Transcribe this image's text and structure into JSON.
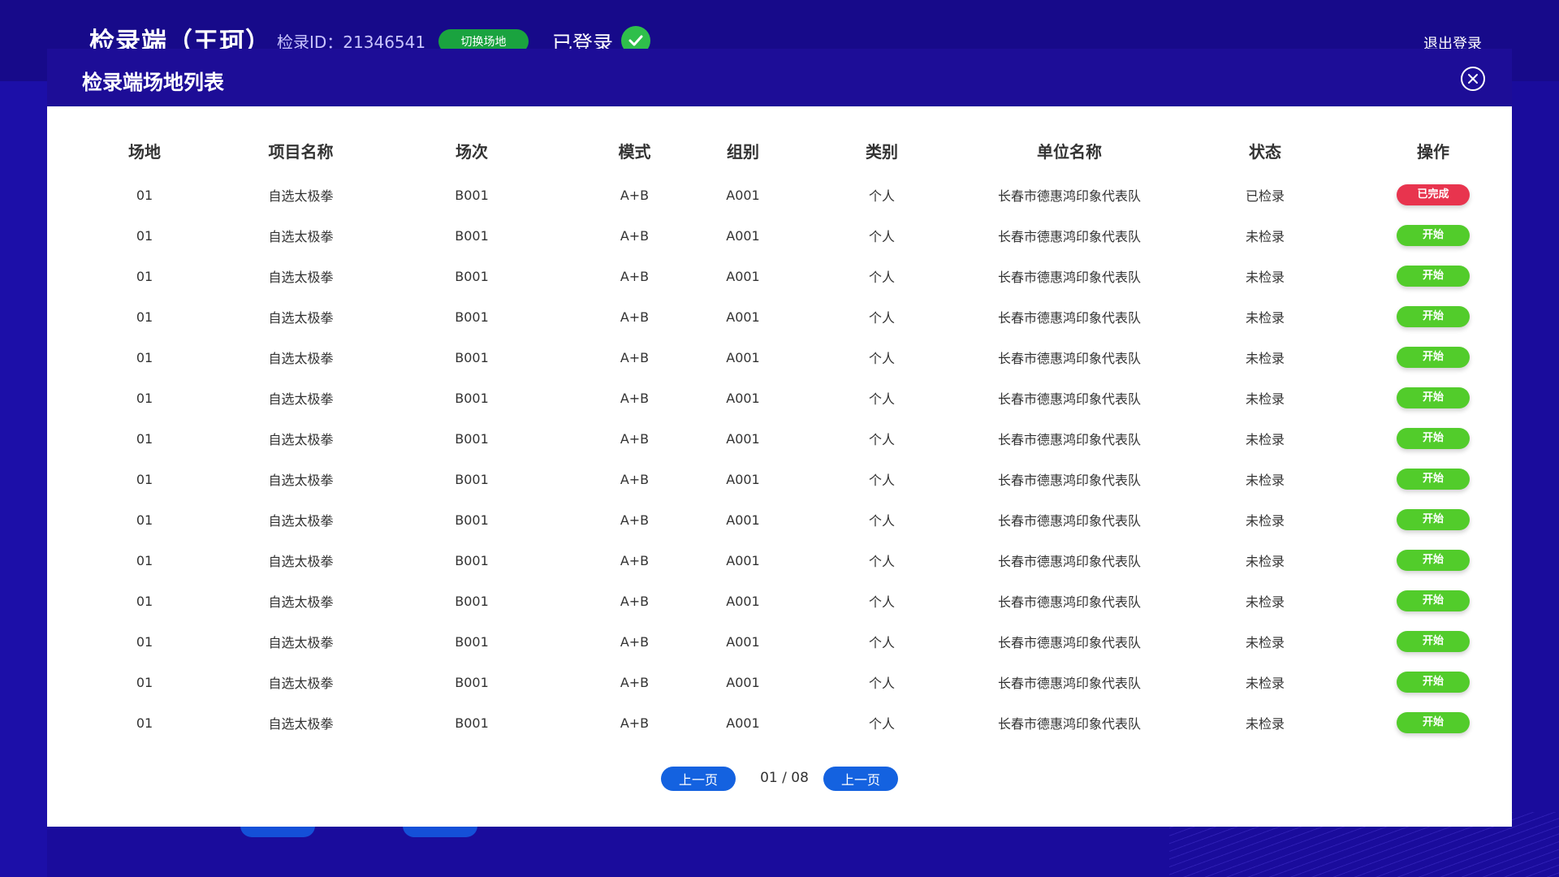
{
  "app": {
    "title": "检录端（王珂）",
    "id_text": "检录ID：21346541",
    "switch_label": "切换场地",
    "logged_in_label": "已登录",
    "logout_label": "退出登录"
  },
  "modal": {
    "title": "检录端场地列表"
  },
  "table": {
    "headers": [
      "场地",
      "项目名称",
      "场次",
      "模式",
      "组别",
      "类别",
      "单位名称",
      "状态",
      "操作"
    ],
    "rows": [
      {
        "venue": "01",
        "project": "自选太极拳",
        "session": "B001",
        "mode": "A+B",
        "group": "A001",
        "category": "个人",
        "unit": "长春市德惠鸿印象代表队",
        "status": "已检录",
        "action": "已完成",
        "action_type": "done"
      },
      {
        "venue": "01",
        "project": "自选太极拳",
        "session": "B001",
        "mode": "A+B",
        "group": "A001",
        "category": "个人",
        "unit": "长春市德惠鸿印象代表队",
        "status": "未检录",
        "action": "开始",
        "action_type": "start"
      },
      {
        "venue": "01",
        "project": "自选太极拳",
        "session": "B001",
        "mode": "A+B",
        "group": "A001",
        "category": "个人",
        "unit": "长春市德惠鸿印象代表队",
        "status": "未检录",
        "action": "开始",
        "action_type": "start"
      },
      {
        "venue": "01",
        "project": "自选太极拳",
        "session": "B001",
        "mode": "A+B",
        "group": "A001",
        "category": "个人",
        "unit": "长春市德惠鸿印象代表队",
        "status": "未检录",
        "action": "开始",
        "action_type": "start"
      },
      {
        "venue": "01",
        "project": "自选太极拳",
        "session": "B001",
        "mode": "A+B",
        "group": "A001",
        "category": "个人",
        "unit": "长春市德惠鸿印象代表队",
        "status": "未检录",
        "action": "开始",
        "action_type": "start"
      },
      {
        "venue": "01",
        "project": "自选太极拳",
        "session": "B001",
        "mode": "A+B",
        "group": "A001",
        "category": "个人",
        "unit": "长春市德惠鸿印象代表队",
        "status": "未检录",
        "action": "开始",
        "action_type": "start"
      },
      {
        "venue": "01",
        "project": "自选太极拳",
        "session": "B001",
        "mode": "A+B",
        "group": "A001",
        "category": "个人",
        "unit": "长春市德惠鸿印象代表队",
        "status": "未检录",
        "action": "开始",
        "action_type": "start"
      },
      {
        "venue": "01",
        "project": "自选太极拳",
        "session": "B001",
        "mode": "A+B",
        "group": "A001",
        "category": "个人",
        "unit": "长春市德惠鸿印象代表队",
        "status": "未检录",
        "action": "开始",
        "action_type": "start"
      },
      {
        "venue": "01",
        "project": "自选太极拳",
        "session": "B001",
        "mode": "A+B",
        "group": "A001",
        "category": "个人",
        "unit": "长春市德惠鸿印象代表队",
        "status": "未检录",
        "action": "开始",
        "action_type": "start"
      },
      {
        "venue": "01",
        "project": "自选太极拳",
        "session": "B001",
        "mode": "A+B",
        "group": "A001",
        "category": "个人",
        "unit": "长春市德惠鸿印象代表队",
        "status": "未检录",
        "action": "开始",
        "action_type": "start"
      },
      {
        "venue": "01",
        "project": "自选太极拳",
        "session": "B001",
        "mode": "A+B",
        "group": "A001",
        "category": "个人",
        "unit": "长春市德惠鸿印象代表队",
        "status": "未检录",
        "action": "开始",
        "action_type": "start"
      },
      {
        "venue": "01",
        "project": "自选太极拳",
        "session": "B001",
        "mode": "A+B",
        "group": "A001",
        "category": "个人",
        "unit": "长春市德惠鸿印象代表队",
        "status": "未检录",
        "action": "开始",
        "action_type": "start"
      },
      {
        "venue": "01",
        "project": "自选太极拳",
        "session": "B001",
        "mode": "A+B",
        "group": "A001",
        "category": "个人",
        "unit": "长春市德惠鸿印象代表队",
        "status": "未检录",
        "action": "开始",
        "action_type": "start"
      },
      {
        "venue": "01",
        "project": "自选太极拳",
        "session": "B001",
        "mode": "A+B",
        "group": "A001",
        "category": "个人",
        "unit": "长春市德惠鸿印象代表队",
        "status": "未检录",
        "action": "开始",
        "action_type": "start"
      }
    ]
  },
  "pager": {
    "prev_label": "上一页",
    "next_label": "上一页",
    "page_info": "01 / 08"
  },
  "colors": {
    "background": "#1a0c9c",
    "modal_header": "#1d0d97",
    "done": "#e8344e",
    "start": "#52cc2b",
    "pager_button": "#1462e0",
    "switch_button": "#1aa33f"
  }
}
